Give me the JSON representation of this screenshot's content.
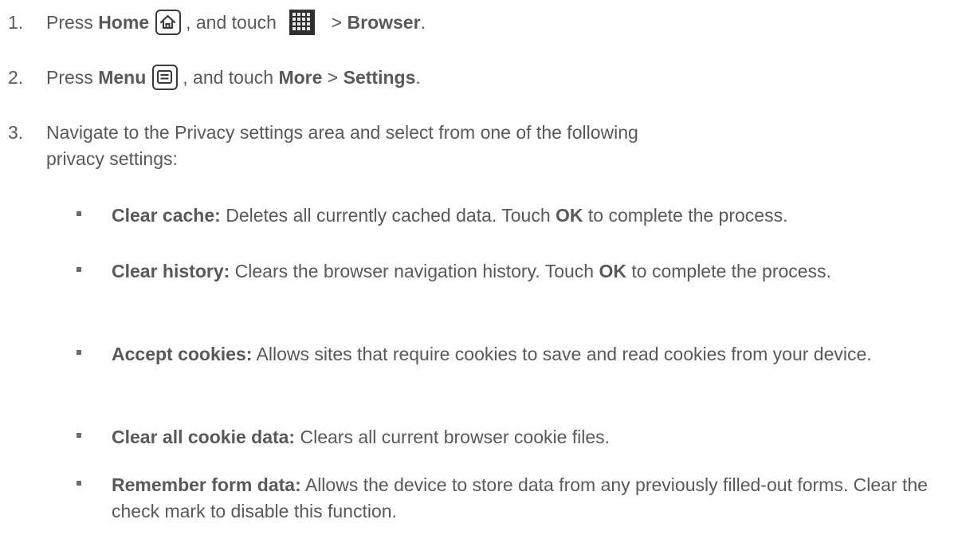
{
  "steps": [
    {
      "num": "1.",
      "press": "Press ",
      "key": "Home",
      "mid": ", and touch ",
      "sep": " > ",
      "target": "Browser",
      "end": ".",
      "icons": [
        "home-icon",
        "apps-grid-icon"
      ]
    },
    {
      "num": "2.",
      "press": "Press ",
      "key": "Menu",
      "mid": ", and touch ",
      "item1": "More",
      "sep": " > ",
      "item2": "Settings",
      "end": ".",
      "icons": [
        "menu-icon"
      ]
    },
    {
      "num": "3.",
      "text": "Navigate to the Privacy settings area and select from one of the following privacy settings:"
    }
  ],
  "bullets": [
    {
      "term": "Clear cache:",
      "desc1": " Deletes all currently cached data. Touch ",
      "strong": "OK",
      "desc2": " to complete the process."
    },
    {
      "term": "Clear history:",
      "desc1": " Clears the browser navigation history. Touch ",
      "strong": "OK",
      "desc2": " to complete the process."
    },
    {
      "term": "Accept cookies:",
      "desc1": " Allows sites that require cookies to save and read cookies from your device."
    },
    {
      "term": "Clear all cookie data:",
      "desc1": " Clears all current browser cookie files."
    },
    {
      "term": "Remember form data:",
      "desc1": " Allows the device to store data from any previously filled-out forms. Clear the check mark to disable this function."
    }
  ],
  "colors": {
    "text": "#595959",
    "icon": "#2f2f2f"
  }
}
